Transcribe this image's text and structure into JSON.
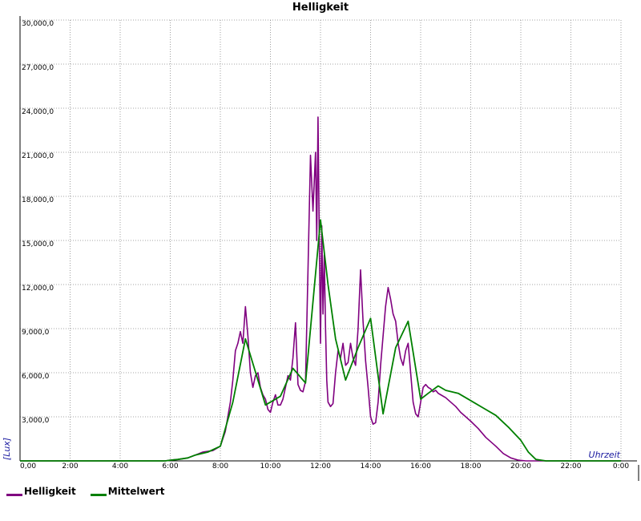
{
  "chart_data": {
    "type": "line",
    "title": "Helligkeit",
    "ylabel": "[Lux]",
    "xlabel": "Uhrzeit",
    "ylim": [
      0,
      30000
    ],
    "xlim": [
      0,
      24
    ],
    "grid": true,
    "legend_position": "bottom-left",
    "y_ticks": [
      "30,000,0",
      "27,000,0",
      "24,000,0",
      "21,000,0",
      "18,000,0",
      "15,000,0",
      "12,000,0",
      "9,000,0",
      "6,000,0",
      "3,000,0"
    ],
    "y_tick_values": [
      30000,
      27000,
      24000,
      21000,
      18000,
      15000,
      12000,
      9000,
      6000,
      3000
    ],
    "zero_label": "0,00",
    "x_ticks": [
      "2:00",
      "4:00",
      "6:00",
      "8:00",
      "10:00",
      "12:00",
      "14:00",
      "16:00",
      "18:00",
      "20:00",
      "22:00",
      "0:00"
    ],
    "x_tick_values": [
      2,
      4,
      6,
      8,
      10,
      12,
      14,
      16,
      18,
      20,
      22,
      24
    ],
    "series": [
      {
        "name": "Helligkeit",
        "color": "#800080",
        "x": [
          0,
          5.8,
          6.0,
          6.3,
          6.7,
          7.0,
          7.3,
          7.7,
          8.0,
          8.2,
          8.4,
          8.5,
          8.6,
          8.7,
          8.8,
          8.9,
          9.0,
          9.1,
          9.2,
          9.3,
          9.4,
          9.5,
          9.6,
          9.7,
          9.8,
          9.9,
          10.0,
          10.1,
          10.2,
          10.3,
          10.4,
          10.5,
          10.6,
          10.7,
          10.8,
          10.9,
          11.0,
          11.1,
          11.2,
          11.3,
          11.4,
          11.5,
          11.6,
          11.7,
          11.8,
          11.85,
          11.9,
          11.95,
          12.0,
          12.05,
          12.1,
          12.15,
          12.2,
          12.25,
          12.3,
          12.4,
          12.5,
          12.6,
          12.7,
          12.8,
          12.9,
          13.0,
          13.1,
          13.2,
          13.3,
          13.4,
          13.5,
          13.6,
          13.7,
          13.8,
          13.9,
          14.0,
          14.1,
          14.2,
          14.3,
          14.4,
          14.5,
          14.6,
          14.7,
          14.8,
          14.9,
          15.0,
          15.1,
          15.2,
          15.3,
          15.4,
          15.5,
          15.6,
          15.7,
          15.8,
          15.9,
          16.0,
          16.1,
          16.2,
          16.3,
          16.4,
          16.5,
          16.6,
          16.7,
          16.8,
          17.0,
          17.2,
          17.4,
          17.6,
          17.8,
          18.0,
          18.3,
          18.6,
          19.0,
          19.3,
          19.6,
          19.9,
          20.2,
          20.5,
          20.8,
          21.0,
          22.0,
          24.0
        ],
        "values": [
          0,
          0,
          50,
          100,
          200,
          400,
          600,
          700,
          1000,
          2000,
          4000,
          5500,
          7500,
          8000,
          8800,
          8000,
          10500,
          8500,
          6000,
          5000,
          5800,
          6000,
          5000,
          4500,
          4200,
          3500,
          3300,
          4000,
          4500,
          3800,
          3800,
          4200,
          5000,
          5800,
          5500,
          7000,
          9400,
          5200,
          4800,
          4700,
          5400,
          13000,
          20800,
          17000,
          21000,
          15000,
          23400,
          15500,
          8000,
          16000,
          10000,
          14000,
          9000,
          5500,
          4000,
          3700,
          3900,
          6000,
          7500,
          7000,
          8000,
          6500,
          6700,
          8000,
          7000,
          6500,
          9000,
          13000,
          9500,
          6800,
          5000,
          3000,
          2500,
          2600,
          4000,
          6500,
          8500,
          10500,
          11800,
          11000,
          10000,
          9500,
          8000,
          7000,
          6500,
          7500,
          8000,
          6000,
          4000,
          3200,
          3000,
          4000,
          5000,
          5200,
          5000,
          4900,
          4700,
          4800,
          4600,
          4500,
          4300,
          4000,
          3700,
          3300,
          3000,
          2700,
          2200,
          1600,
          1000,
          500,
          200,
          50,
          0,
          0,
          0,
          0,
          0,
          0
        ],
        "values_note": ""
      },
      {
        "name": "Mittelwert",
        "color": "#008000",
        "x": [
          0,
          5.8,
          6.0,
          6.3,
          6.7,
          7.0,
          7.5,
          8.0,
          8.5,
          9.0,
          9.8,
          10.4,
          10.9,
          11.4,
          12.0,
          12.3,
          12.6,
          13.0,
          13.5,
          14.0,
          14.5,
          15.0,
          15.5,
          16.0,
          16.3,
          16.7,
          17.0,
          17.5,
          18.0,
          18.5,
          19.0,
          19.5,
          20.0,
          20.3,
          20.6,
          21.0,
          22.0,
          24.0
        ],
        "values": [
          0,
          0,
          50,
          100,
          200,
          400,
          600,
          1000,
          4000,
          8300,
          3800,
          4400,
          6300,
          5300,
          16400,
          12000,
          8300,
          5500,
          7700,
          9700,
          3200,
          7700,
          9500,
          4200,
          4600,
          5100,
          4800,
          4600,
          4100,
          3600,
          3100,
          2300,
          1400,
          600,
          100,
          0,
          0,
          0
        ]
      }
    ]
  }
}
